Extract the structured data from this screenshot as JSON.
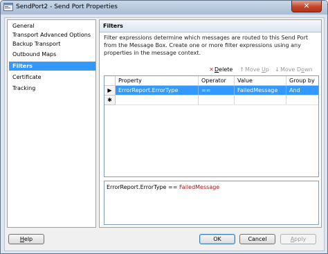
{
  "window": {
    "title": "SendPort2 - Send Port Properties",
    "close_glyph": "✕"
  },
  "nav": {
    "items": [
      {
        "label": "General"
      },
      {
        "label": "Transport Advanced Options"
      },
      {
        "label": "Backup Transport"
      },
      {
        "label": "Outbound Maps"
      },
      {
        "label": "Filters"
      },
      {
        "label": "Certificate"
      },
      {
        "label": "Tracking"
      }
    ],
    "selected": "Filters"
  },
  "panel": {
    "header": "Filters",
    "description": "Filter expressions determine which messages are routed to this Send Port from the Message Box. Create one or more filter expressions using any properties in the message context."
  },
  "toolbar": {
    "delete": {
      "pre": "",
      "mnemonic": "D",
      "post": "elete"
    },
    "move_up": {
      "pre": "Move ",
      "mnemonic": "U",
      "post": "p"
    },
    "move_down": {
      "pre": "Move D",
      "mnemonic": "o",
      "post": "wn"
    }
  },
  "grid": {
    "columns": [
      "Property",
      "Operator",
      "Value",
      "Group by"
    ],
    "rows": [
      {
        "property": "ErrorReport.ErrorType",
        "operator": "==",
        "value": "FailedMessage",
        "group_by": "And"
      }
    ],
    "current_row_glyph": "▶",
    "new_row_glyph": "✱"
  },
  "expression": {
    "property": "ErrorReport.ErrorType",
    "operator": "==",
    "value": "FailedMessage"
  },
  "buttons": {
    "help": {
      "mnemonic": "H",
      "rest": "elp"
    },
    "ok": "OK",
    "cancel": "Cancel",
    "apply": {
      "mnemonic": "A",
      "rest": "pply"
    }
  },
  "colors": {
    "selection": "#3399ff",
    "expression_value": "#a31515",
    "delete_icon": "#c0392b"
  }
}
